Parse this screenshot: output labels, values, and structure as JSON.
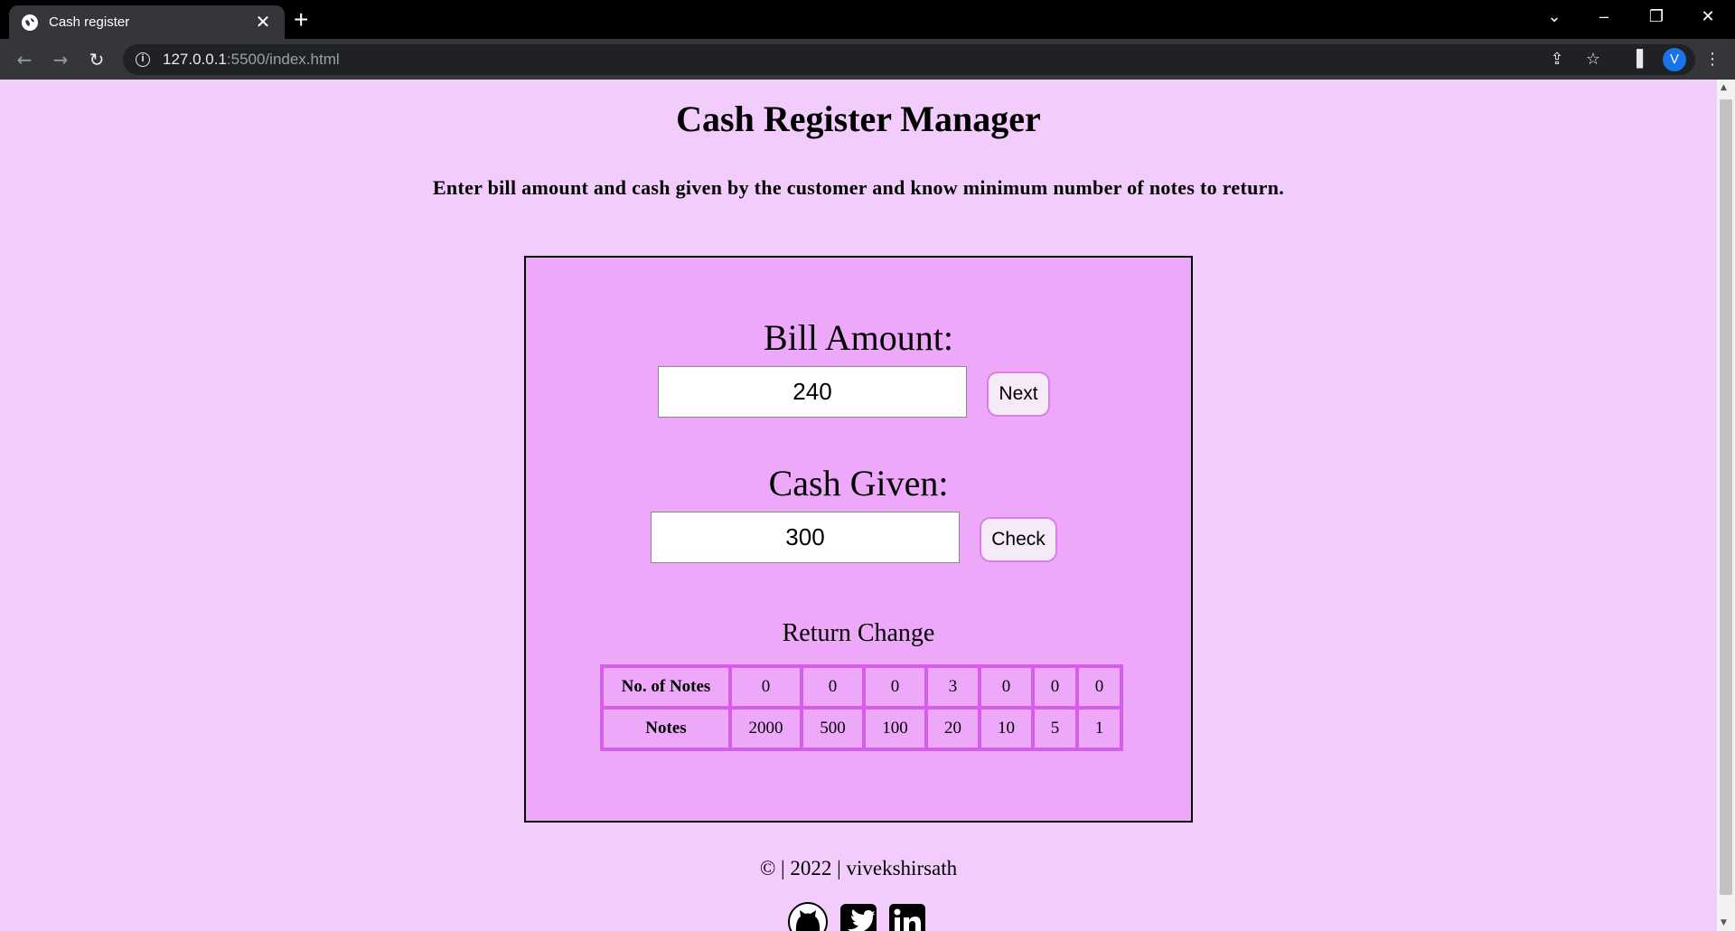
{
  "browser": {
    "tab_title": "Cash register",
    "url_host": "127.0.0.1",
    "url_path": ":5500/index.html",
    "profile_initial": "V"
  },
  "page": {
    "title": "Cash Register Manager",
    "description": "Enter bill amount and cash given by the customer and know minimum number of notes to return."
  },
  "form": {
    "bill_label": "Bill Amount:",
    "bill_value": "240",
    "next_button": "Next",
    "cash_label": "Cash Given:",
    "cash_value": "300",
    "check_button": "Check"
  },
  "change_table": {
    "title": "Return Change",
    "row1_header": "No. of Notes",
    "counts": [
      "0",
      "0",
      "0",
      "3",
      "0",
      "0",
      "0"
    ],
    "row2_header": "Notes",
    "notes": [
      "2000",
      "500",
      "100",
      "20",
      "10",
      "5",
      "1"
    ]
  },
  "footer": {
    "text": "© | 2022 | vivekshirsath",
    "social_icons": [
      "github-icon",
      "twitter-icon",
      "linkedin-icon"
    ]
  },
  "colors": {
    "page_bg": "#f2cdfc",
    "card_bg": "#eea8fa",
    "table_border": "#d45fe8"
  }
}
